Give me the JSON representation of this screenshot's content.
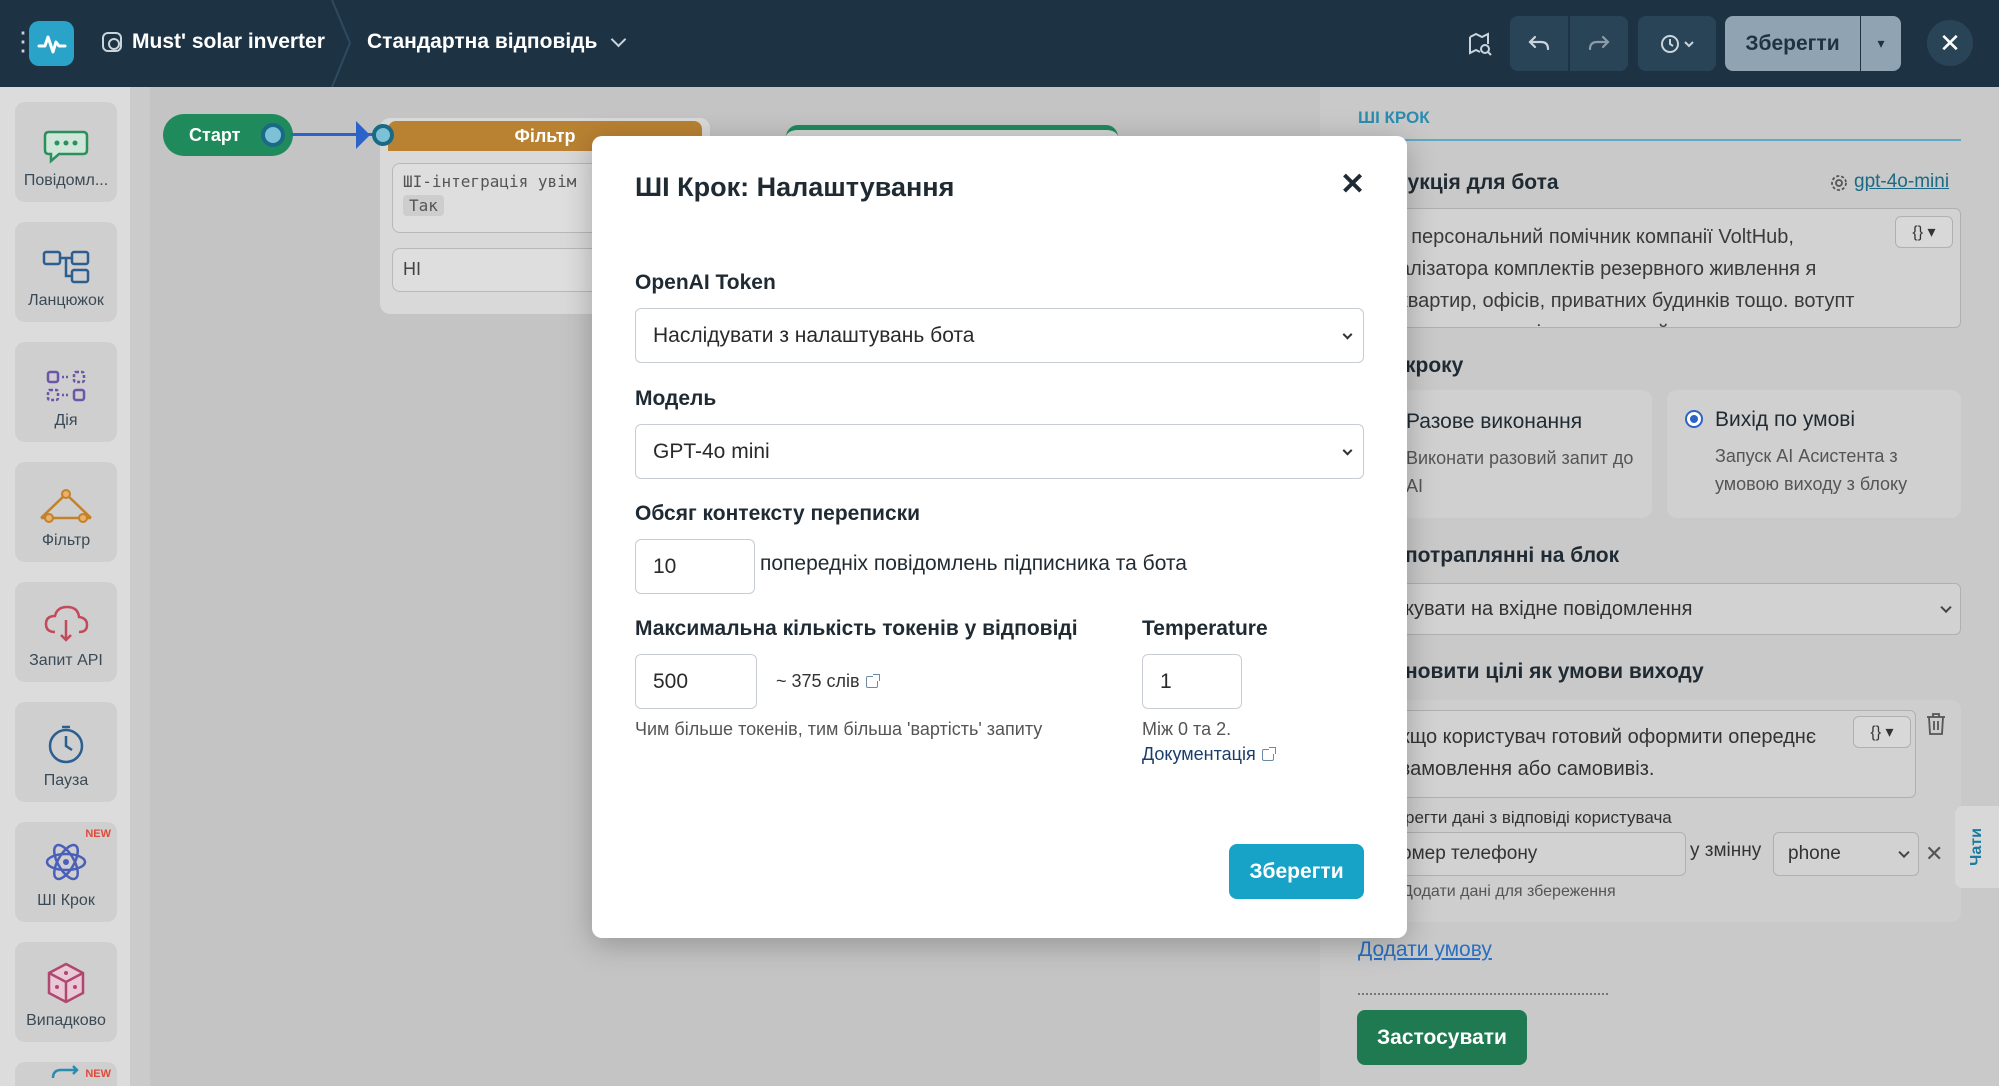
{
  "topbar": {
    "bot_name": "Must' solar inverter",
    "flow_name": "Стандартна відповідь",
    "save_label": "Зберегти"
  },
  "sidebar": {
    "items": [
      {
        "label": "Повідомл...",
        "icon": "chat-icon",
        "new": ""
      },
      {
        "label": "Ланцюжок",
        "icon": "chain-icon",
        "new": ""
      },
      {
        "label": "Дія",
        "icon": "action-icon",
        "new": ""
      },
      {
        "label": "Фільтр",
        "icon": "filter-icon",
        "new": ""
      },
      {
        "label": "Запит API",
        "icon": "api-cloud-icon",
        "new": ""
      },
      {
        "label": "Пауза",
        "icon": "clock-icon",
        "new": ""
      },
      {
        "label": "ШІ Крок",
        "icon": "ai-atom-icon",
        "new": "NEW"
      },
      {
        "label": "Випадково",
        "icon": "dice-icon",
        "new": ""
      },
      {
        "label": "",
        "icon": "repeat-icon",
        "new": "NEW"
      }
    ]
  },
  "canvas": {
    "start_label": "Старт",
    "filter_label": "Фільтр",
    "filter_condition": "ШІ-інтеграція увім",
    "filter_value": "Так",
    "filter_else": "HI"
  },
  "right_panel": {
    "section_title": "ШІ КРОК",
    "instruction_title": "рукція для бота",
    "model_link": "gpt-4o-mini",
    "code_btn": "{} ▾",
    "instruction_text": "- персональний помічник компанії VoltHub, алізатора комплектів резервного живлення я квартир, офісів, приватних будинків тощо. вотупт кориототиод о іприортором й окиниятоп",
    "step_type_title": "кроку",
    "option_once_title": "Разове виконання",
    "option_once_desc": "Виконати разовий запит до AI",
    "option_cond_title": "Вихід по умові",
    "option_cond_desc": "Запуск AI Асистента з умовою виходу з блоку",
    "on_enter_title": "потраплянні на блок",
    "on_enter_value": "кувати на вхідне повідомлення",
    "goals_title": "новити цілі як умови виходу",
    "condition_text": "кщо користувач готовий оформити опереднє замовлення або самовивіз.",
    "save_data_label": "регти дані з відповіді користувача",
    "field_value": "омер телефону",
    "to_var_label": "у змінну",
    "var_value": "phone",
    "add_data_label": "Додати дані для збереження",
    "add_condition": "Додати умову",
    "apply_label": "Застосувати",
    "chats_tab": "Чати"
  },
  "modal": {
    "title": "ШІ Крок: Налаштування",
    "token_label": "OpenAI Token",
    "token_value": "Наслідувати з налаштувань бота",
    "model_label": "Модель",
    "model_value": "GPT-4o mini",
    "context_label": "Обсяг контексту переписки",
    "context_value": "10",
    "context_suffix": "попередніх повідомлень підписника та бота",
    "max_tokens_label": "Максимальна кількість токенів у відповіді",
    "max_tokens_value": "500",
    "words_estimate": "~ 375 слів",
    "tokens_hint": "Чим більше токенів, тим більша 'вартість' запиту",
    "temp_label": "Temperature",
    "temp_value": "1",
    "temp_hint": "Між 0 та 2.",
    "docs_link": "Документація",
    "save_label": "Зберегти"
  }
}
